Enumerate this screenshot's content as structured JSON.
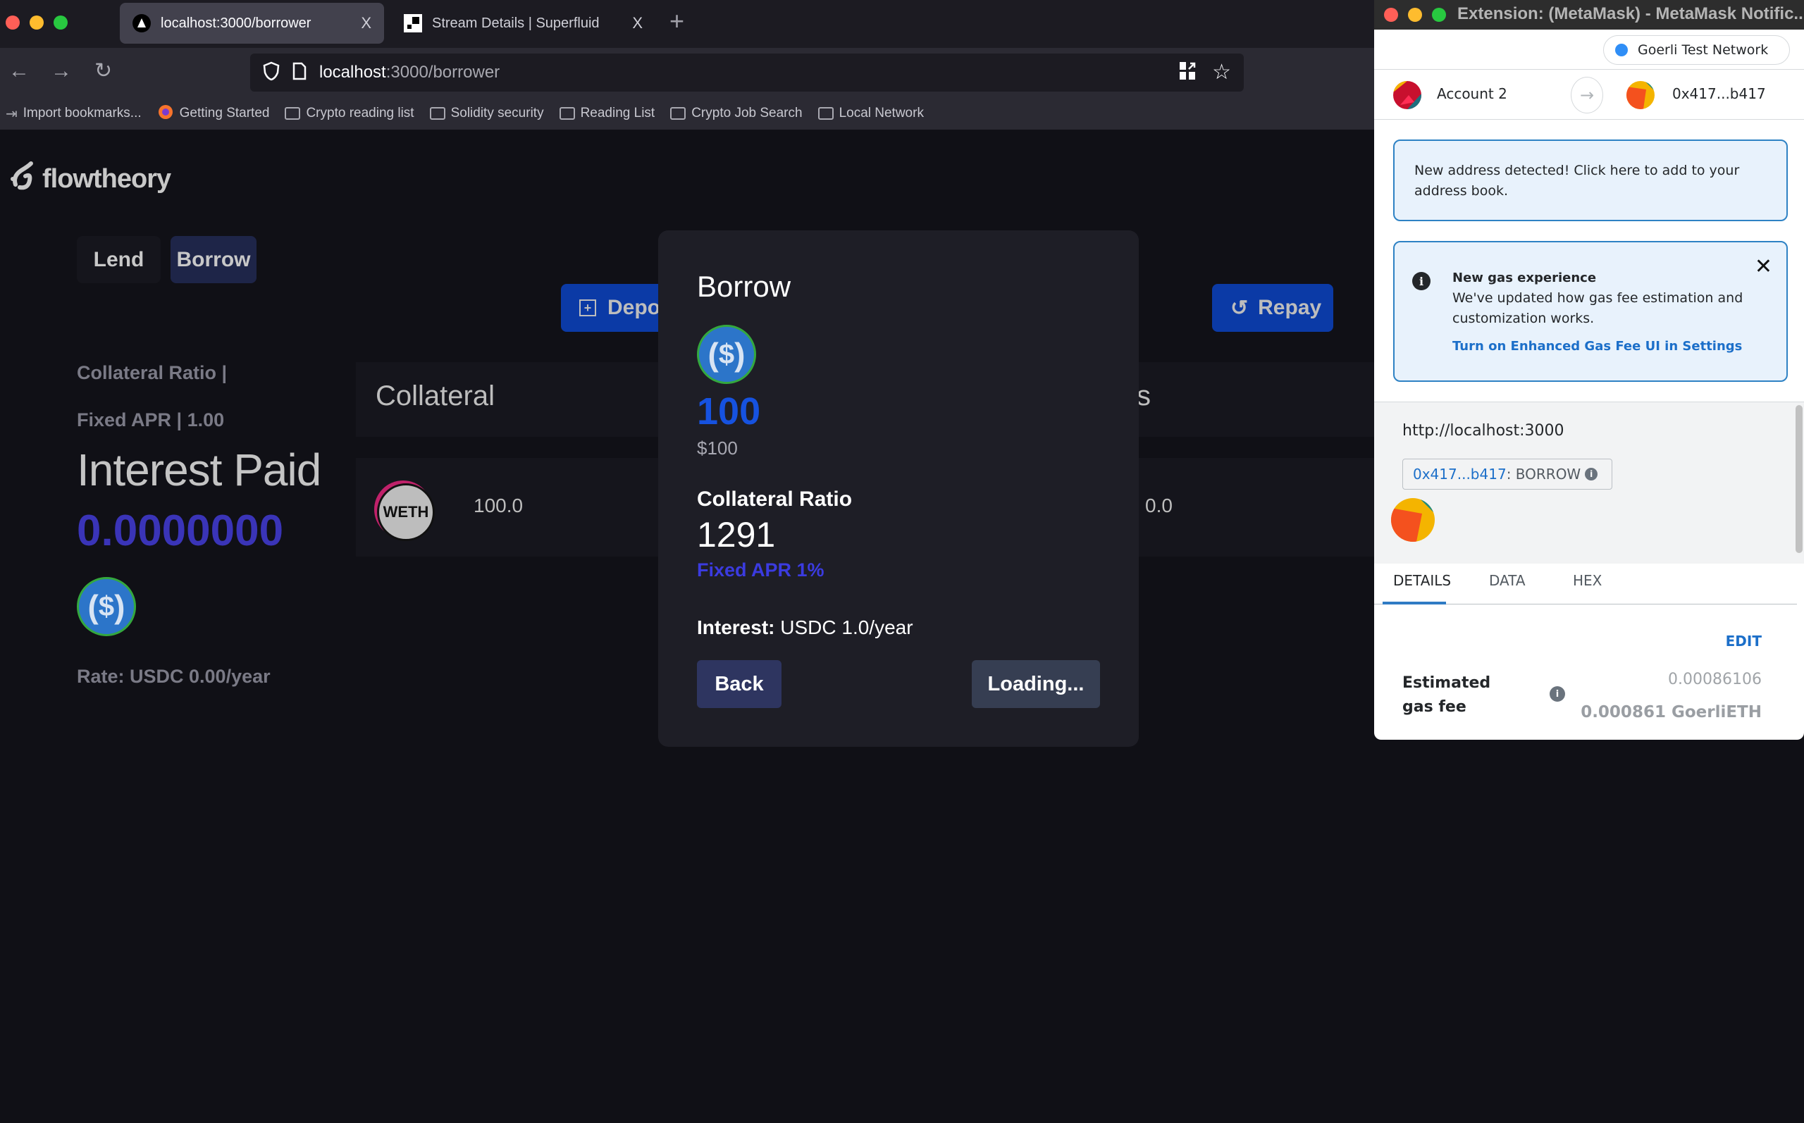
{
  "browser": {
    "tabs": [
      {
        "label": "localhost:3000/borrower",
        "active": true
      },
      {
        "label": "Stream Details | Superfluid",
        "active": false
      }
    ],
    "new_tab_symbol": "+",
    "close_symbol": "X",
    "url": {
      "host": "localhost",
      "path": ":3000/borrower"
    },
    "bookmarks": [
      {
        "label": "Import bookmarks...",
        "icon": "import-icon"
      },
      {
        "label": "Getting Started",
        "icon": "firefox-icon"
      },
      {
        "label": "Crypto reading list",
        "icon": "folder-icon"
      },
      {
        "label": "Solidity security",
        "icon": "folder-icon"
      },
      {
        "label": "Reading List",
        "icon": "folder-icon"
      },
      {
        "label": "Crypto Job Search",
        "icon": "folder-icon"
      },
      {
        "label": "Local Network",
        "icon": "folder-icon"
      }
    ]
  },
  "app": {
    "logo_text": "flowtheory",
    "nav": {
      "lend": "Lend",
      "borrow": "Borrow"
    },
    "summary": {
      "collateral_ratio": "Collateral Ratio |",
      "fixed_apr": "Fixed APR | 1.00",
      "interest_title": "Interest Paid",
      "interest_value": "0.0000000",
      "token_symbol": "$",
      "rate": "Rate: USDC 0.00/year"
    },
    "table": {
      "headers": {
        "collateral": "Collateral",
        "right_partial": "s"
      },
      "row": {
        "token": "WETH",
        "collateral_amount": "100.0",
        "deposit_label": "Deposit",
        "borrow_amount": "0.0",
        "repay_label": "Repay"
      }
    }
  },
  "modal": {
    "title": "Borrow",
    "token_symbol": "$",
    "amount": "100",
    "amount_usd": "$100",
    "collateral_ratio_label": "Collateral Ratio",
    "collateral_ratio_value": "1291",
    "fixed_apr": "Fixed APR 1%",
    "interest_label": "Interest:",
    "interest_value": " USDC 1.0/year",
    "back_label": "Back",
    "loading_label": "Loading..."
  },
  "metamask": {
    "window_title": "Extension: (MetaMask) - MetaMask Notific...",
    "network": "Goerli Test Network",
    "from_account": "Account 2",
    "to_address": "0x417...b417",
    "notice_address": "New address detected! Click here to add to your address book.",
    "gas_notice": {
      "title": "New gas experience",
      "body": "We've updated how gas fee estimation and customization works.",
      "link": "Turn on Enhanced Gas Fee UI in Settings"
    },
    "origin": "http://localhost:3000",
    "method_address": "0x417...b417",
    "method_name": " : BORROW",
    "tabs": [
      "DETAILS",
      "DATA",
      "HEX"
    ],
    "edit_label": "EDIT",
    "gas_label": "Estimated gas fee",
    "gas_secondary": "0.00086106",
    "gas_primary": "0.000861 GoerliETH"
  }
}
